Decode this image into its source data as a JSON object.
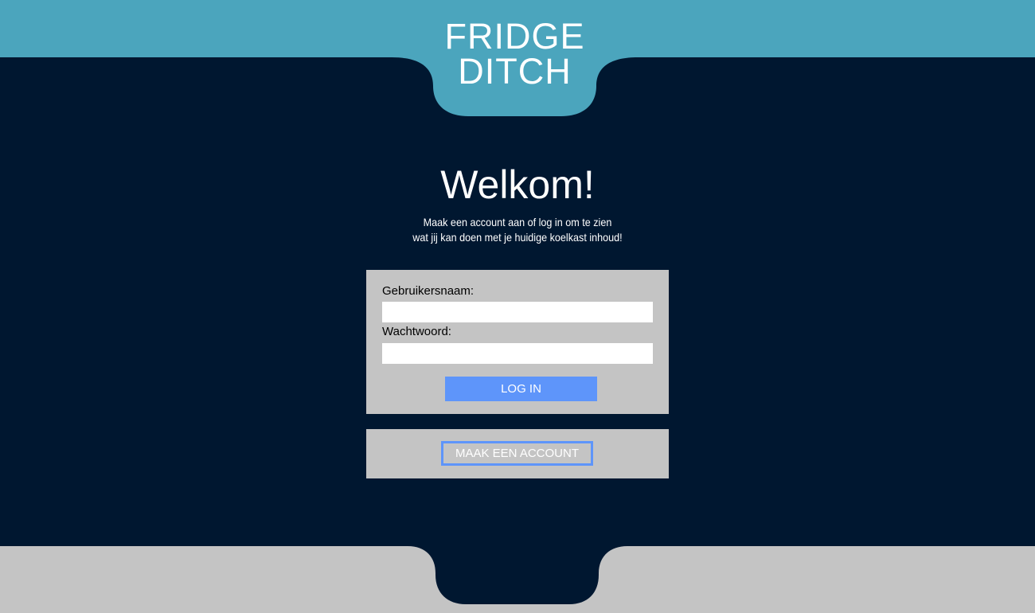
{
  "brand": {
    "line1": "FRIDGE",
    "line2": "DITCH"
  },
  "colors": {
    "header": "#4ba5bd",
    "background": "#001730",
    "panel": "#c4c4c4",
    "accent": "#5e95fa"
  },
  "welcome": {
    "title": "Welkom!",
    "subtitle_line1": "Maak een account aan of log in om te zien",
    "subtitle_line2": "wat jij kan doen met je huidige koelkast inhoud!"
  },
  "login": {
    "username_label": "Gebruikersnaam:",
    "username_value": "",
    "password_label": "Wachtwoord:",
    "password_value": "",
    "submit_label": "LOG IN"
  },
  "signup": {
    "button_label": "MAAK EEN ACCOUNT"
  }
}
